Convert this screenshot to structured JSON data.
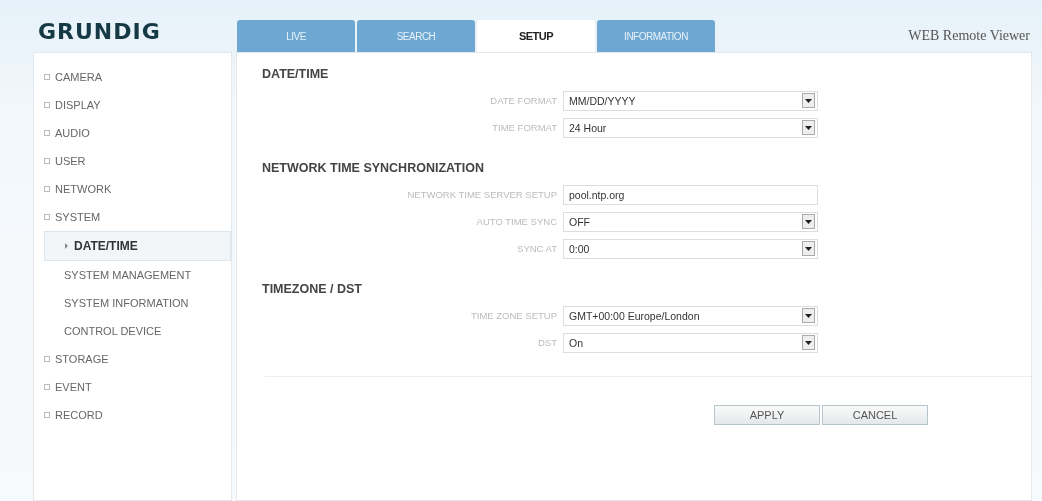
{
  "logo": "GRUNDIG",
  "tabs": [
    {
      "label": "LIVE",
      "selected": false
    },
    {
      "label": "SEARCH",
      "selected": false
    },
    {
      "label": "SETUP",
      "selected": true
    },
    {
      "label": "INFORMATION",
      "selected": false
    }
  ],
  "app_title": "WEB Remote Viewer",
  "sidebar": {
    "items": [
      {
        "label": "CAMERA",
        "kind": "group",
        "selected": false
      },
      {
        "label": "DISPLAY",
        "kind": "group",
        "selected": false
      },
      {
        "label": "AUDIO",
        "kind": "group",
        "selected": false
      },
      {
        "label": "USER",
        "kind": "group",
        "selected": false
      },
      {
        "label": "NETWORK",
        "kind": "group",
        "selected": false
      },
      {
        "label": "SYSTEM",
        "kind": "group",
        "selected": false
      },
      {
        "label": "DATE/TIME",
        "kind": "child",
        "selected": true
      },
      {
        "label": "SYSTEM MANAGEMENT",
        "kind": "child",
        "selected": false
      },
      {
        "label": "SYSTEM INFORMATION",
        "kind": "child",
        "selected": false
      },
      {
        "label": "CONTROL DEVICE",
        "kind": "child",
        "selected": false
      },
      {
        "label": "STORAGE",
        "kind": "group",
        "selected": false
      },
      {
        "label": "EVENT",
        "kind": "group",
        "selected": false
      },
      {
        "label": "RECORD",
        "kind": "group",
        "selected": false
      }
    ]
  },
  "sections": [
    {
      "title": "DATE/TIME",
      "fields": [
        {
          "label": "DATE FORMAT",
          "kind": "select",
          "value": "MM/DD/YYYY"
        },
        {
          "label": "TIME FORMAT",
          "kind": "select",
          "value": "24 Hour"
        }
      ]
    },
    {
      "title": "NETWORK TIME SYNCHRONIZATION",
      "fields": [
        {
          "label": "NETWORK TIME SERVER SETUP",
          "kind": "text",
          "value": "pool.ntp.org"
        },
        {
          "label": "AUTO TIME SYNC",
          "kind": "select",
          "value": "OFF"
        },
        {
          "label": "SYNC AT",
          "kind": "select",
          "value": "0:00"
        }
      ]
    },
    {
      "title": "TIMEZONE / DST",
      "fields": [
        {
          "label": "TIME ZONE SETUP",
          "kind": "select",
          "value": "GMT+00:00 Europe/London"
        },
        {
          "label": "DST",
          "kind": "select",
          "value": "On"
        }
      ]
    }
  ],
  "buttons": [
    "APPLY",
    "CANCEL"
  ]
}
